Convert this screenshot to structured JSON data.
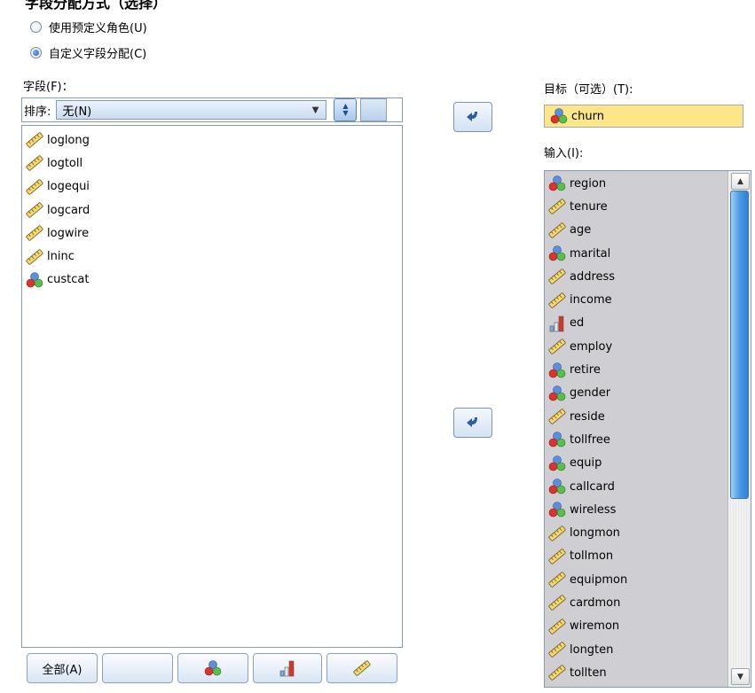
{
  "header": {
    "partial_title": "字段分配方式（选择）"
  },
  "role_options": [
    {
      "label": "使用预定义角色(U)",
      "selected": false
    },
    {
      "label": "自定义字段分配(C)",
      "selected": true
    }
  ],
  "fields_panel": {
    "label": "字段(F)：",
    "sort_label": "排序:",
    "sort_value": "无(N)",
    "fields": [
      {
        "name": "loglong",
        "icon": "scale-icon"
      },
      {
        "name": "logtoll",
        "icon": "scale-icon"
      },
      {
        "name": "logequi",
        "icon": "scale-icon"
      },
      {
        "name": "logcard",
        "icon": "scale-icon"
      },
      {
        "name": "logwire",
        "icon": "scale-icon"
      },
      {
        "name": "lninc",
        "icon": "scale-icon"
      },
      {
        "name": "custcat",
        "icon": "nominal-icon"
      }
    ],
    "buttons": {
      "all": "全部(A)"
    }
  },
  "target_panel": {
    "label": "目标（可选）(T):",
    "value": "churn",
    "icon": "nominal-icon",
    "highlight": "#fbe78a"
  },
  "inputs_panel": {
    "label": "输入(I):",
    "fields": [
      {
        "name": "region",
        "icon": "nominal-icon"
      },
      {
        "name": "tenure",
        "icon": "scale-icon"
      },
      {
        "name": "age",
        "icon": "scale-icon"
      },
      {
        "name": "marital",
        "icon": "nominal-icon"
      },
      {
        "name": "address",
        "icon": "scale-icon"
      },
      {
        "name": "income",
        "icon": "scale-icon"
      },
      {
        "name": "ed",
        "icon": "ordinal-icon"
      },
      {
        "name": "employ",
        "icon": "scale-icon"
      },
      {
        "name": "retire",
        "icon": "nominal-icon"
      },
      {
        "name": "gender",
        "icon": "nominal-icon"
      },
      {
        "name": "reside",
        "icon": "scale-icon"
      },
      {
        "name": "tollfree",
        "icon": "nominal-icon"
      },
      {
        "name": "equip",
        "icon": "nominal-icon"
      },
      {
        "name": "callcard",
        "icon": "nominal-icon"
      },
      {
        "name": "wireless",
        "icon": "nominal-icon"
      },
      {
        "name": "longmon",
        "icon": "scale-icon"
      },
      {
        "name": "tollmon",
        "icon": "scale-icon"
      },
      {
        "name": "equipmon",
        "icon": "scale-icon"
      },
      {
        "name": "cardmon",
        "icon": "scale-icon"
      },
      {
        "name": "wiremon",
        "icon": "scale-icon"
      },
      {
        "name": "longten",
        "icon": "scale-icon"
      },
      {
        "name": "tollten",
        "icon": "scale-icon"
      }
    ],
    "background": "#cfcfd3"
  }
}
